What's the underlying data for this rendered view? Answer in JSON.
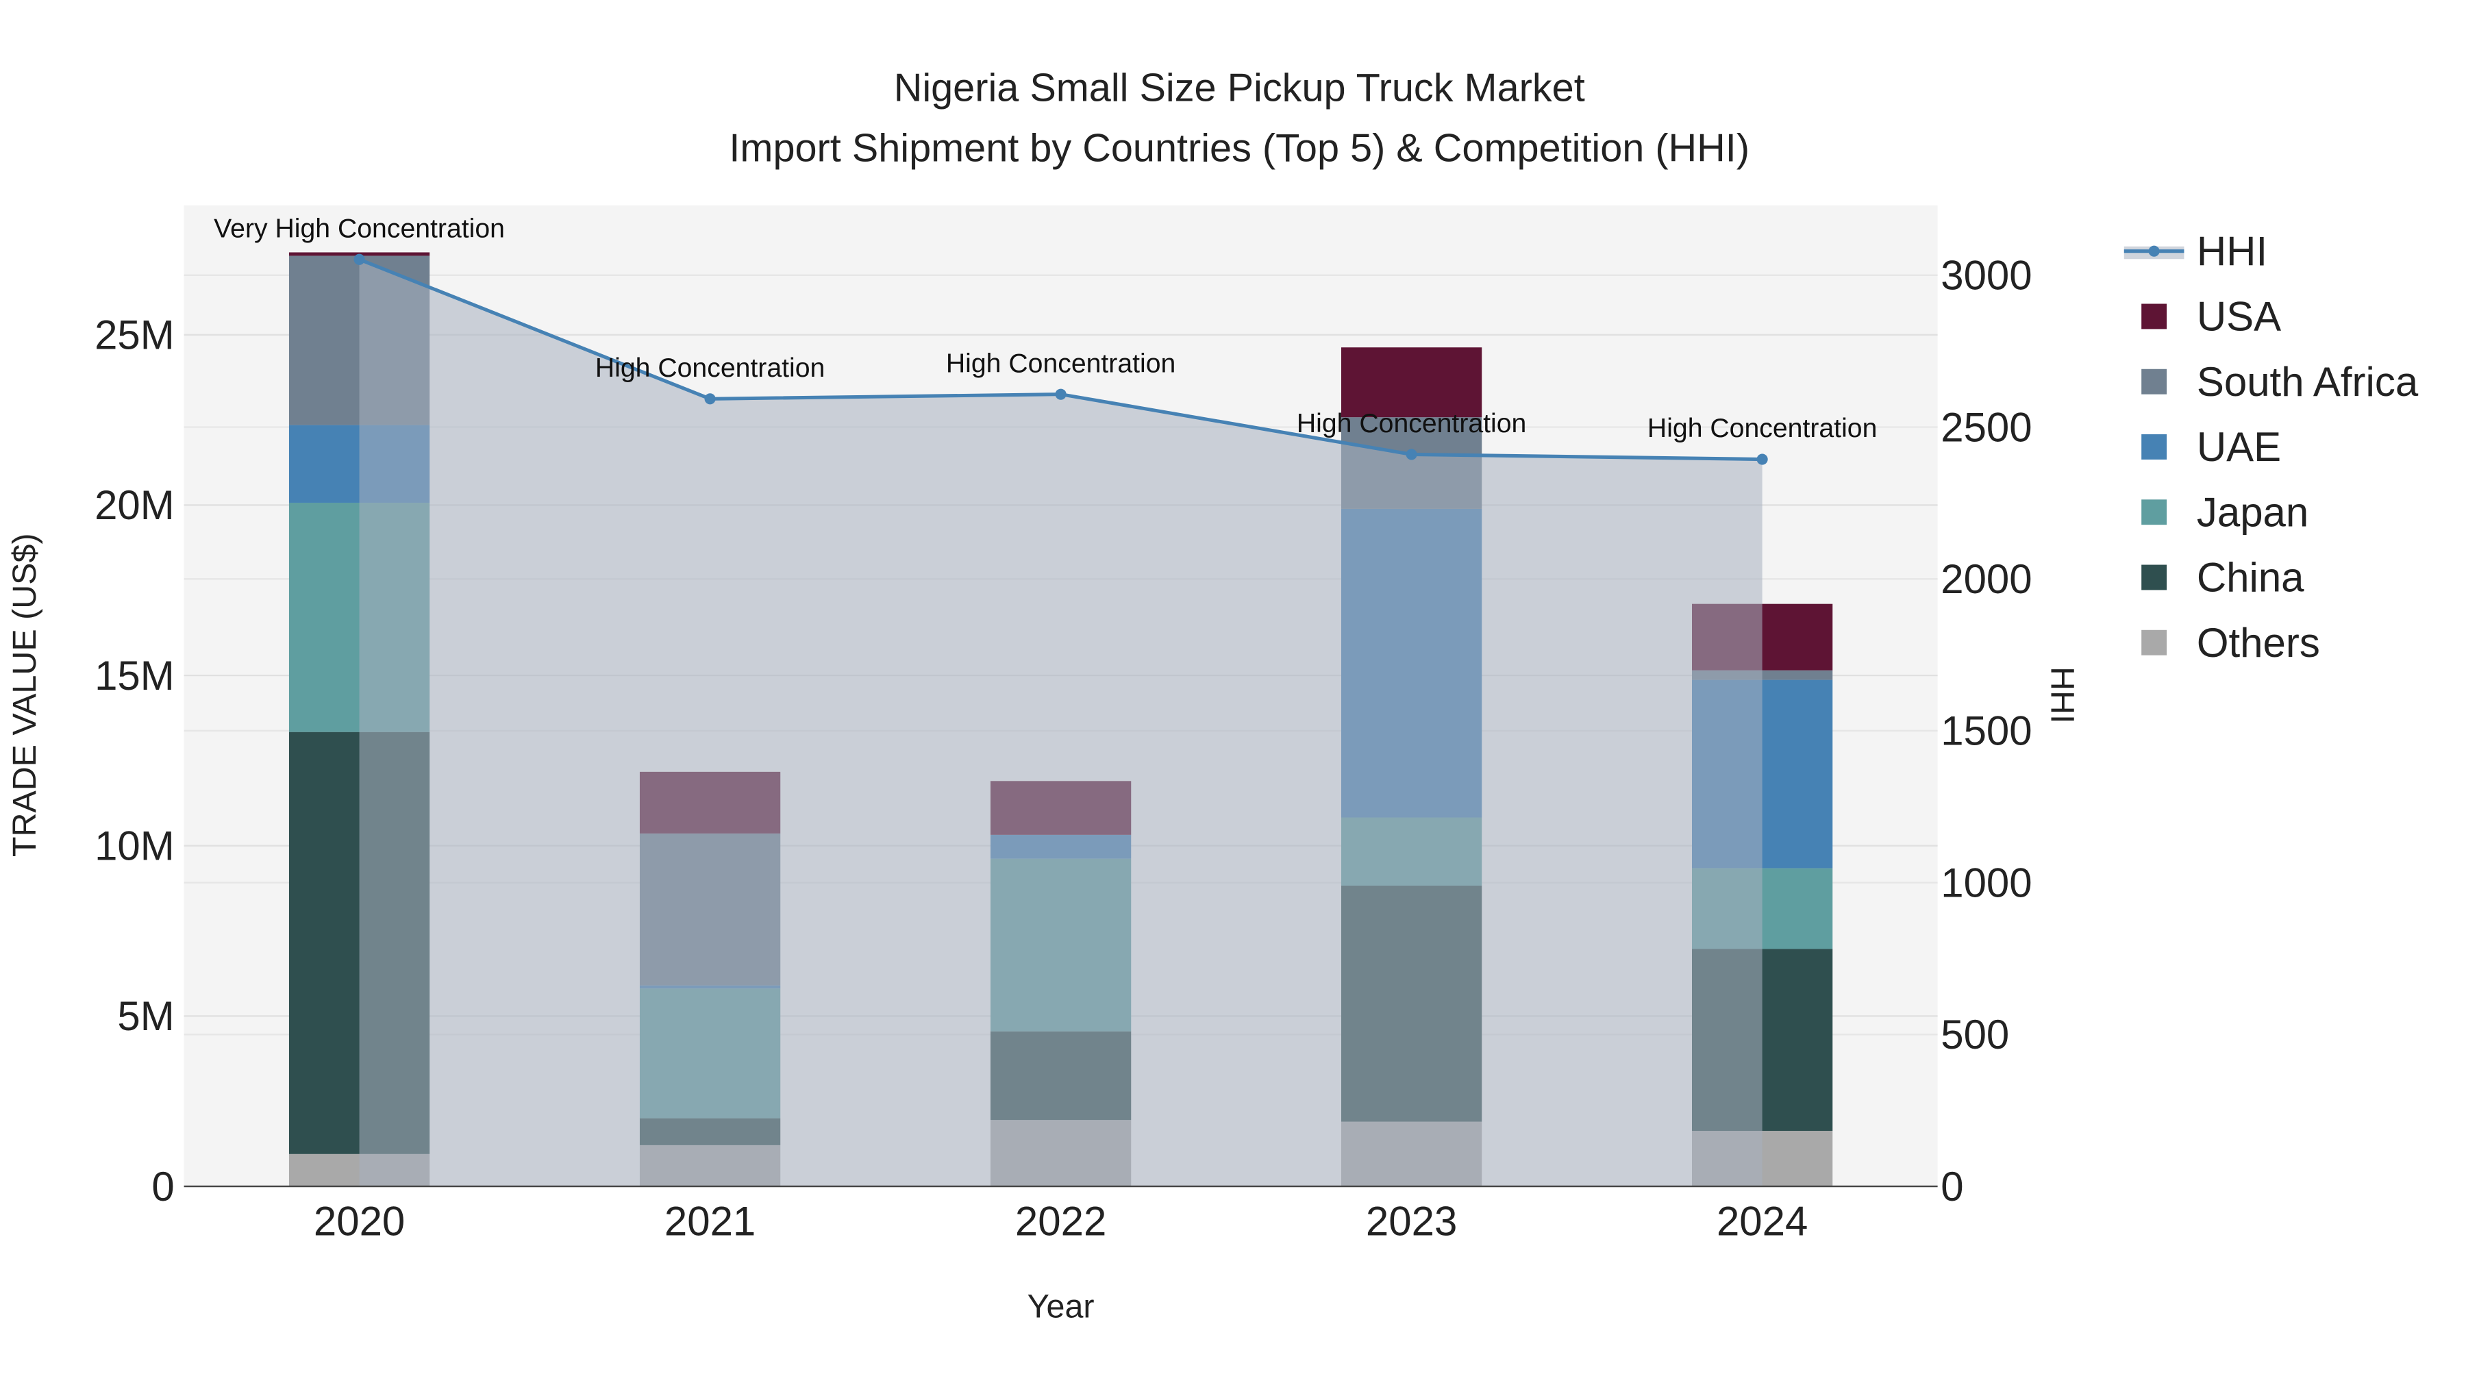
{
  "chart_data": {
    "type": "bar",
    "stacked": true,
    "title": "Nigeria Small Size Pickup Truck Market",
    "subtitle": "Import Shipment by Countries (Top 5) & Competition (HHI)",
    "xlabel": "Year",
    "ylabel": "TRADE VALUE (US$)",
    "y2label": "HHI",
    "categories": [
      "2020",
      "2021",
      "2022",
      "2023",
      "2024"
    ],
    "ylim": [
      0,
      28800000
    ],
    "y2lim": [
      0,
      3230
    ],
    "yticks": [
      0,
      5000000,
      10000000,
      15000000,
      20000000,
      25000000
    ],
    "ytick_labels": [
      "0",
      "5M",
      "10M",
      "15M",
      "20M",
      "25M"
    ],
    "y2ticks": [
      0,
      500,
      1000,
      1500,
      2000,
      2500,
      3000
    ],
    "y2tick_labels": [
      "0",
      "500",
      "1000",
      "1500",
      "2000",
      "2500",
      "3000"
    ],
    "grid": true,
    "legend_position": "right",
    "series": [
      {
        "name": "Others",
        "color": "#a9a9a9",
        "values": [
          950000,
          1210000,
          1950000,
          1900000,
          1630000
        ]
      },
      {
        "name": "China",
        "color": "#2f4f4f",
        "values": [
          12390000,
          790000,
          2600000,
          6930000,
          5340000
        ]
      },
      {
        "name": "Japan",
        "color": "#5f9ea0",
        "values": [
          6730000,
          3810000,
          5070000,
          2000000,
          2370000
        ]
      },
      {
        "name": "UAE",
        "color": "#4682b4",
        "values": [
          2280000,
          90000,
          700000,
          9060000,
          5530000
        ]
      },
      {
        "name": "South Africa",
        "color": "#708090",
        "values": [
          4970000,
          4460000,
          0,
          2690000,
          280000
        ]
      },
      {
        "name": "USA",
        "color": "#5e1434",
        "values": [
          100000,
          1810000,
          1580000,
          2050000,
          1950000
        ]
      }
    ],
    "line": {
      "name": "HHI",
      "color": "#4682b4",
      "values": [
        3052,
        2593,
        2608,
        2410,
        2394
      ],
      "annotations": [
        "Very High Concentration",
        "High Concentration",
        "High Concentration",
        "High Concentration",
        "High Concentration"
      ]
    },
    "legend": [
      "HHI",
      "USA",
      "South Africa",
      "UAE",
      "Japan",
      "China",
      "Others"
    ]
  }
}
